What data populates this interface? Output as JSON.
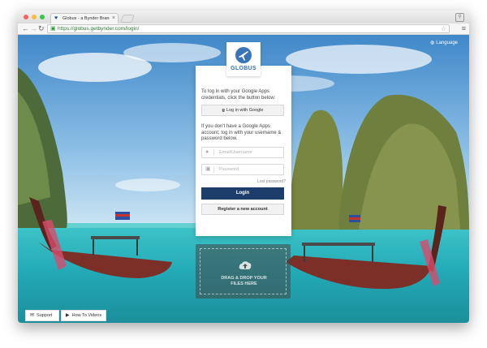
{
  "browser": {
    "tab_title": "Globus - a Bynder Brand P",
    "tab_close": "×",
    "url": "https://globus.getbynder.com/login/"
  },
  "page": {
    "language_label": "Language"
  },
  "login": {
    "logo_text": "GLOBUS",
    "google_intro": "To log in with your Google Apps credentials, click the button below:",
    "google_button": "Log in with Google",
    "no_google_text": "If you don't have a Google Apps account, log in with your username & password below.",
    "username_placeholder": "Email/Username",
    "password_placeholder": "Password",
    "lost_password": "Lost password?",
    "login_button": "Login",
    "register_button": "Register a new account"
  },
  "dropzone": {
    "line1": "DRAG & DROP YOUR",
    "line2": "FILES HERE"
  },
  "footer": {
    "support_label": "Support",
    "videos_label": "How To Videos"
  },
  "icons": {
    "favicon": "globus-favicon-icon",
    "lock": "lock-icon",
    "star": "bookmark-star-icon",
    "menu": "hamburger-menu-icon",
    "globe": "globe-icon",
    "user": "user-icon",
    "padlock": "padlock-icon",
    "cloud": "cloud-upload-icon",
    "chat": "chat-icon",
    "play": "play-icon"
  },
  "colors": {
    "brand_blue": "#3a73b8",
    "login_button": "#1d3d6b",
    "url_green": "#2e7d32"
  }
}
